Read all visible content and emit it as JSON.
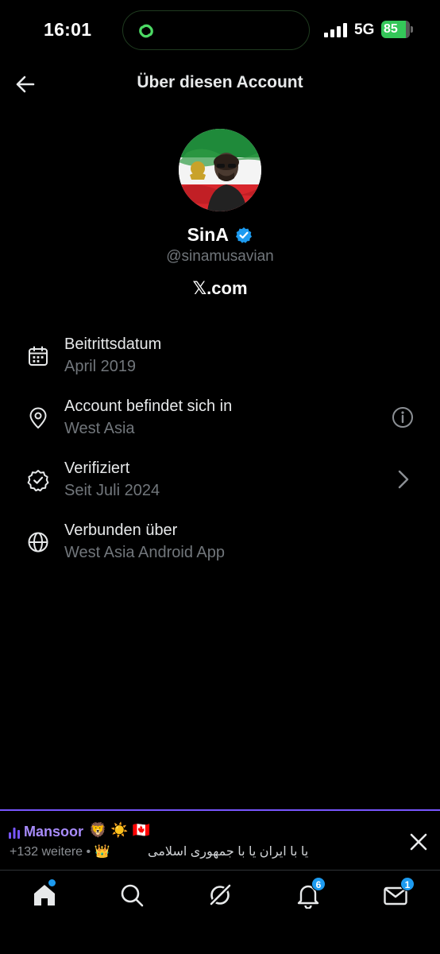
{
  "status_bar": {
    "time": "16:01",
    "network": "5G",
    "battery": "85",
    "battery_level": 0.85
  },
  "header": {
    "title": "Über diesen Account",
    "back_icon": "arrow-left-icon"
  },
  "profile": {
    "display_name": "SinA",
    "handle": "@sinamusavian",
    "site": "𝕏.com",
    "verified": true,
    "colors": {
      "verified_badge": "#1d9bf0"
    }
  },
  "info": [
    {
      "title": "Beitrittsdatum",
      "value": "April 2019",
      "icon": "calendar-icon"
    },
    {
      "title": "Account befindet sich in",
      "value": "West Asia",
      "icon": "location-pin-icon",
      "action_icon": "info-circle-icon"
    },
    {
      "title": "Verifiziert",
      "value": "Seit Juli 2024",
      "icon": "verified-badge-icon",
      "action_icon": "chevron-right-icon"
    },
    {
      "title": "Verbunden über",
      "value": "West Asia Android App",
      "icon": "globe-icon"
    }
  ],
  "space_banner": {
    "host": "Mansoor",
    "host_emojis": "🦁 ☀️ 🇨🇦",
    "listeners": "+132 weitere • 👑",
    "title": "یا با ایران یا با جمهوری اسلامی",
    "accent": "#7856ff"
  },
  "bottom_nav": {
    "items": [
      {
        "name": "home",
        "icon": "home-icon",
        "dot": true
      },
      {
        "name": "search",
        "icon": "search-icon"
      },
      {
        "name": "grok",
        "icon": "grok-icon"
      },
      {
        "name": "notifications",
        "icon": "bell-icon",
        "badge": "6"
      },
      {
        "name": "messages",
        "icon": "envelope-icon",
        "badge": "1"
      }
    ]
  }
}
